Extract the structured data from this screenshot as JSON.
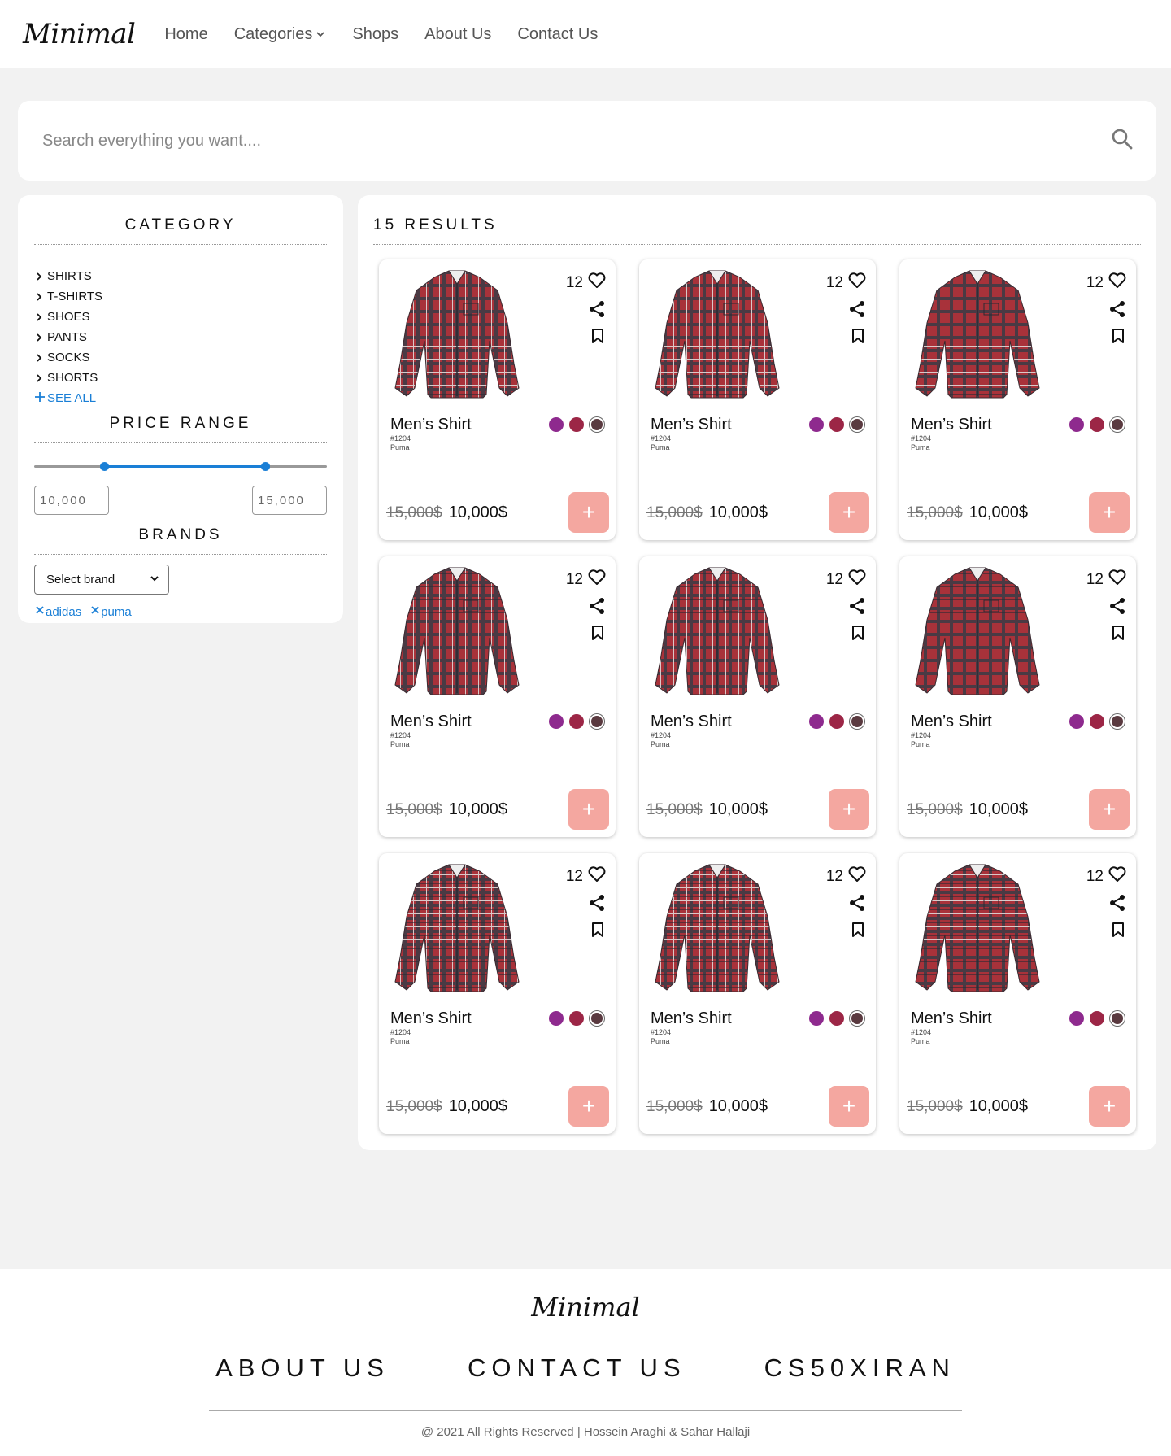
{
  "header": {
    "logo": "Minimal",
    "nav": [
      {
        "label": "Home"
      },
      {
        "label": "Categories"
      },
      {
        "label": "Shops"
      },
      {
        "label": "About Us"
      },
      {
        "label": "Contact Us"
      }
    ]
  },
  "search": {
    "placeholder": "Search everything you want...."
  },
  "sidebar": {
    "category_heading": "CATEGORY",
    "categories": [
      "SHIRTS",
      "T-SHIRTS",
      "SHOES",
      "PANTS",
      "SOCKS",
      "SHORTS"
    ],
    "see_all": "SEE ALL",
    "price_heading": "PRICE RANGE",
    "price_min": "10,000",
    "price_max": "15,000",
    "price_range_selected": [
      0.24,
      0.79
    ],
    "brands_heading": "BRANDS",
    "brand_select": "Select brand",
    "brand_tags": [
      "adidas",
      "puma"
    ]
  },
  "results": {
    "heading": "15 RESULTS",
    "products": [
      {
        "likes": "12",
        "name": "Men’s Shirt",
        "sku": "#1204",
        "brand": "Puma",
        "old_price": "15,000$",
        "price": "10,000$"
      },
      {
        "likes": "12",
        "name": "Men’s Shirt",
        "sku": "#1204",
        "brand": "Puma",
        "old_price": "15,000$",
        "price": "10,000$"
      },
      {
        "likes": "12",
        "name": "Men’s Shirt",
        "sku": "#1204",
        "brand": "Puma",
        "old_price": "15,000$",
        "price": "10,000$"
      },
      {
        "likes": "12",
        "name": "Men’s Shirt",
        "sku": "#1204",
        "brand": "Puma",
        "old_price": "15,000$",
        "price": "10,000$"
      },
      {
        "likes": "12",
        "name": "Men’s Shirt",
        "sku": "#1204",
        "brand": "Puma",
        "old_price": "15,000$",
        "price": "10,000$"
      },
      {
        "likes": "12",
        "name": "Men’s Shirt",
        "sku": "#1204",
        "brand": "Puma",
        "old_price": "15,000$",
        "price": "10,000$"
      },
      {
        "likes": "12",
        "name": "Men’s Shirt",
        "sku": "#1204",
        "brand": "Puma",
        "old_price": "15,000$",
        "price": "10,000$"
      },
      {
        "likes": "12",
        "name": "Men’s Shirt",
        "sku": "#1204",
        "brand": "Puma",
        "old_price": "15,000$",
        "price": "10,000$"
      },
      {
        "likes": "12",
        "name": "Men’s Shirt",
        "sku": "#1204",
        "brand": "Puma",
        "old_price": "15,000$",
        "price": "10,000$"
      }
    ],
    "swatch_colors": [
      "#8e2a8e",
      "#9c2646",
      "#5a3a40"
    ],
    "add_label": "+"
  },
  "footer": {
    "logo": "Minimal",
    "links": [
      "ABOUT US",
      "CONTACT US",
      "CS50XIRAN"
    ],
    "copyright": "@ 2021 All Rights Reserved | Hossein Araghi & Sahar Hallaji"
  },
  "colors": {
    "accent": "#1a7fd6",
    "add_button": "#f4a7a0",
    "page_bg": "#f2f2f2"
  },
  "icons": {
    "search": "search-icon",
    "like": "heart-icon",
    "share": "share-icon",
    "bookmark": "bookmark-icon",
    "chevron": "chevron-right-icon",
    "close": "close-icon"
  }
}
